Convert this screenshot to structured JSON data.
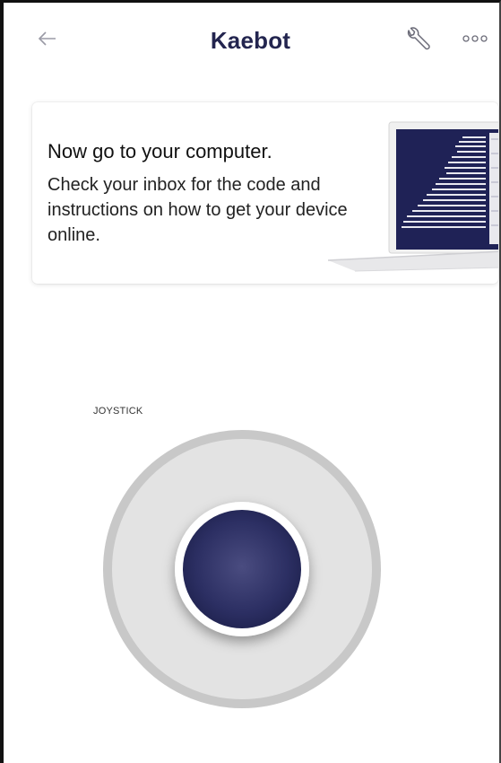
{
  "header": {
    "title": "Kaebot",
    "back_icon": "arrow-left-icon",
    "settings_icon": "wrench-icon",
    "more_icon": "more-horizontal-icon"
  },
  "card": {
    "title": "Now go to your computer.",
    "body": "Check your inbox for the code and instructions on how to get your device online.",
    "illustration": "laptop-icon"
  },
  "joystick": {
    "label": "JOYSTICK"
  },
  "colors": {
    "title": "#23254f",
    "knob": "#2c2f63",
    "ring": "#c8c8c8",
    "base": "#e3e3e3"
  }
}
